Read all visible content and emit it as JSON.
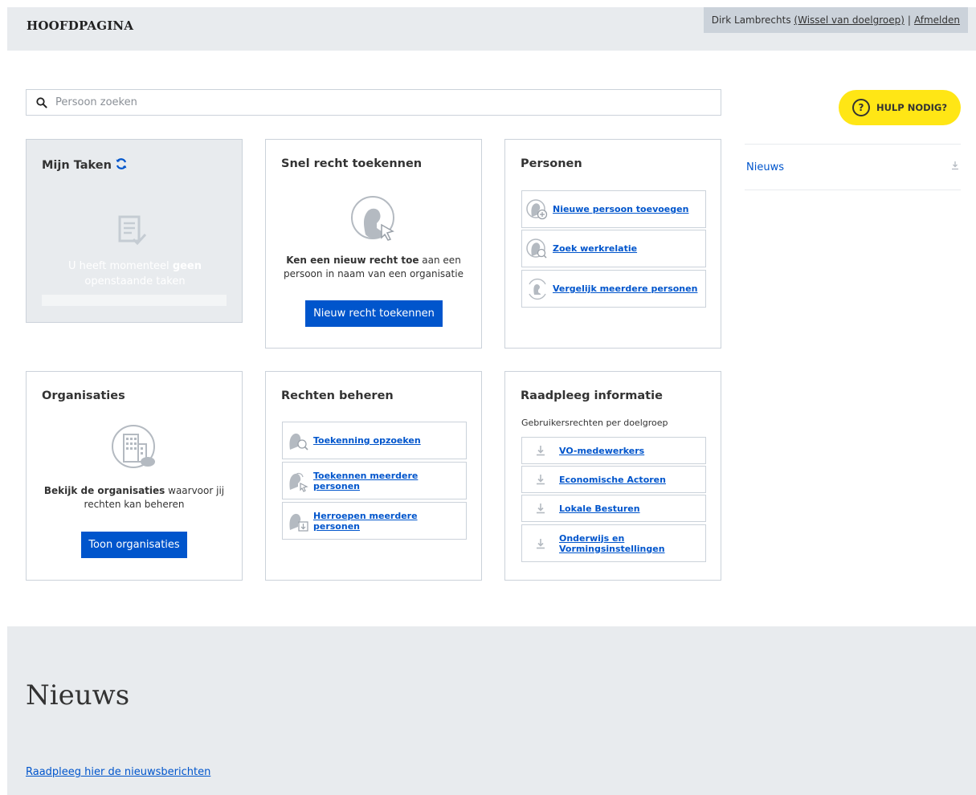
{
  "header": {
    "title": "HOOFDPAGINA",
    "user_name": "Dirk Lambrechts",
    "switch_group_link": "(Wissel van doelgroep)",
    "separator": "|",
    "logout_link": "Afmelden"
  },
  "search": {
    "placeholder": "Persoon zoeken"
  },
  "help": {
    "label": "HULP NODIG?",
    "icon_glyph": "?"
  },
  "side_news": {
    "label": "Nieuws"
  },
  "tasks": {
    "title": "Mijn Taken",
    "empty_text_before": "U heeft momenteel ",
    "empty_text_bold": "geen",
    "empty_text_after": " openstaande taken"
  },
  "quick_grant": {
    "title": "Snel recht toekennen",
    "text_bold": "Ken een nieuw recht toe",
    "text_rest": " aan een persoon in naam van een organisatie",
    "button": "Nieuw recht toekennen"
  },
  "persons": {
    "title": "Personen",
    "links": [
      "Nieuwe persoon toevoegen",
      "Zoek werkrelatie",
      "Vergelijk meerdere personen"
    ]
  },
  "organisations": {
    "title": "Organisaties",
    "text_bold": "Bekijk de organisaties",
    "text_rest": " waarvoor jij rechten kan beheren",
    "button": "Toon organisaties"
  },
  "rights": {
    "title": "Rechten beheren",
    "links": [
      "Toekenning opzoeken",
      "Toekennen meerdere personen",
      "Herroepen meerdere personen"
    ]
  },
  "info": {
    "title": "Raadpleeg informatie",
    "subtitle": "Gebruikersrechten per doelgroep",
    "links": [
      "VO-medewerkers",
      "Economische Actoren",
      "Lokale Besturen",
      "Onderwijs en Vormingsinstellingen"
    ]
  },
  "footer": {
    "title": "Nieuws",
    "link": "Raadpleeg hier de nieuwsberichten"
  },
  "colors": {
    "primary": "#0055cc",
    "help_yellow": "#ffe615",
    "panel_grey": "#e8ebee",
    "border": "#cbd2da"
  }
}
